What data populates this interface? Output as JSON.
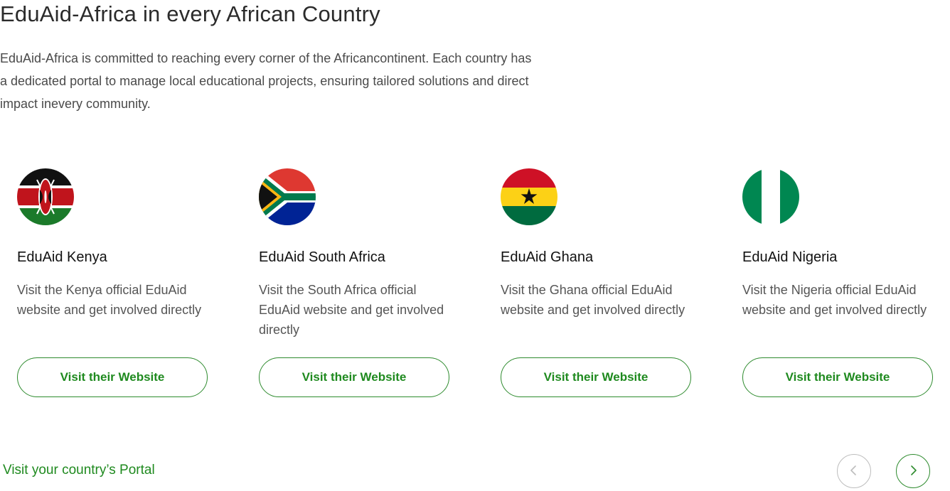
{
  "section": {
    "heading": "EduAid-Africa in every African Country",
    "intro": "EduAid-Africa is committed to reaching every corner of the Africancontinent. Each country has a dedicated portal to manage local educational projects, ensuring tailored solutions and direct impact inevery community."
  },
  "cards": [
    {
      "flag_icon": "kenya-flag-icon",
      "title": "EduAid Kenya",
      "description": "Visit the Kenya  official EduAid website and get involved directly",
      "button_label": "Visit their Website"
    },
    {
      "flag_icon": "south-africa-flag-icon",
      "title": "EduAid South Africa",
      "description": "Visit the South Africa official EduAid website and get involved directly",
      "button_label": "Visit their Website"
    },
    {
      "flag_icon": "ghana-flag-icon",
      "title": "EduAid Ghana",
      "description": "Visit the Ghana official EduAid website and get involved directly",
      "button_label": "Visit their Website"
    },
    {
      "flag_icon": "nigeria-flag-icon",
      "title": "EduAid Nigeria",
      "description": "Visit the Nigeria official EduAid website and get involved directly",
      "button_label": "Visit their Website"
    }
  ],
  "footer": {
    "portal_link": "Visit your country’s Portal",
    "prev_icon": "chevron-left-icon",
    "next_icon": "chevron-right-icon"
  },
  "colors": {
    "accent_green": "#1f8a1f",
    "heading_text": "#2b2b2b",
    "body_text": "#555555",
    "disabled_border": "#bdbdbd"
  }
}
